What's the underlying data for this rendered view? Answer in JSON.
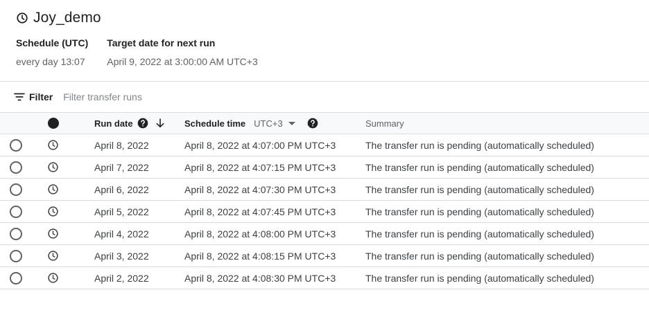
{
  "config": {
    "title": "Joy_demo",
    "schedule_label": "Schedule (UTC)",
    "schedule_value": "every day 13:07",
    "next_run_label": "Target date for next run",
    "next_run_value": "April 9, 2022 at 3:00:00 AM UTC+3"
  },
  "filter": {
    "label": "Filter",
    "placeholder": "Filter transfer runs",
    "value": ""
  },
  "table": {
    "headers": {
      "status_icon": "filled-circle-icon",
      "run_date": "Run date",
      "schedule_time": "Schedule time",
      "timezone": "UTC+3",
      "summary": "Summary"
    },
    "sort": {
      "column": "run_date",
      "direction": "descending"
    },
    "rows": [
      {
        "status": "clock-icon",
        "run_date": "April 8, 2022",
        "schedule_time": "April 8, 2022 at 4:07:00 PM UTC+3",
        "summary": "The transfer run is pending (automatically scheduled)"
      },
      {
        "status": "clock-icon",
        "run_date": "April 7, 2022",
        "schedule_time": "April 8, 2022 at 4:07:15 PM UTC+3",
        "summary": "The transfer run is pending (automatically scheduled)"
      },
      {
        "status": "clock-icon",
        "run_date": "April 6, 2022",
        "schedule_time": "April 8, 2022 at 4:07:30 PM UTC+3",
        "summary": "The transfer run is pending (automatically scheduled)"
      },
      {
        "status": "clock-icon",
        "run_date": "April 5, 2022",
        "schedule_time": "April 8, 2022 at 4:07:45 PM UTC+3",
        "summary": "The transfer run is pending (automatically scheduled)"
      },
      {
        "status": "clock-icon",
        "run_date": "April 4, 2022",
        "schedule_time": "April 8, 2022 at 4:08:00 PM UTC+3",
        "summary": "The transfer run is pending (automatically scheduled)"
      },
      {
        "status": "clock-icon",
        "run_date": "April 3, 2022",
        "schedule_time": "April 8, 2022 at 4:08:15 PM UTC+3",
        "summary": "The transfer run is pending (automatically scheduled)"
      },
      {
        "status": "clock-icon",
        "run_date": "April 2, 2022",
        "schedule_time": "April 8, 2022 at 4:08:30 PM UTC+3",
        "summary": "The transfer run is pending (automatically scheduled)"
      }
    ]
  }
}
